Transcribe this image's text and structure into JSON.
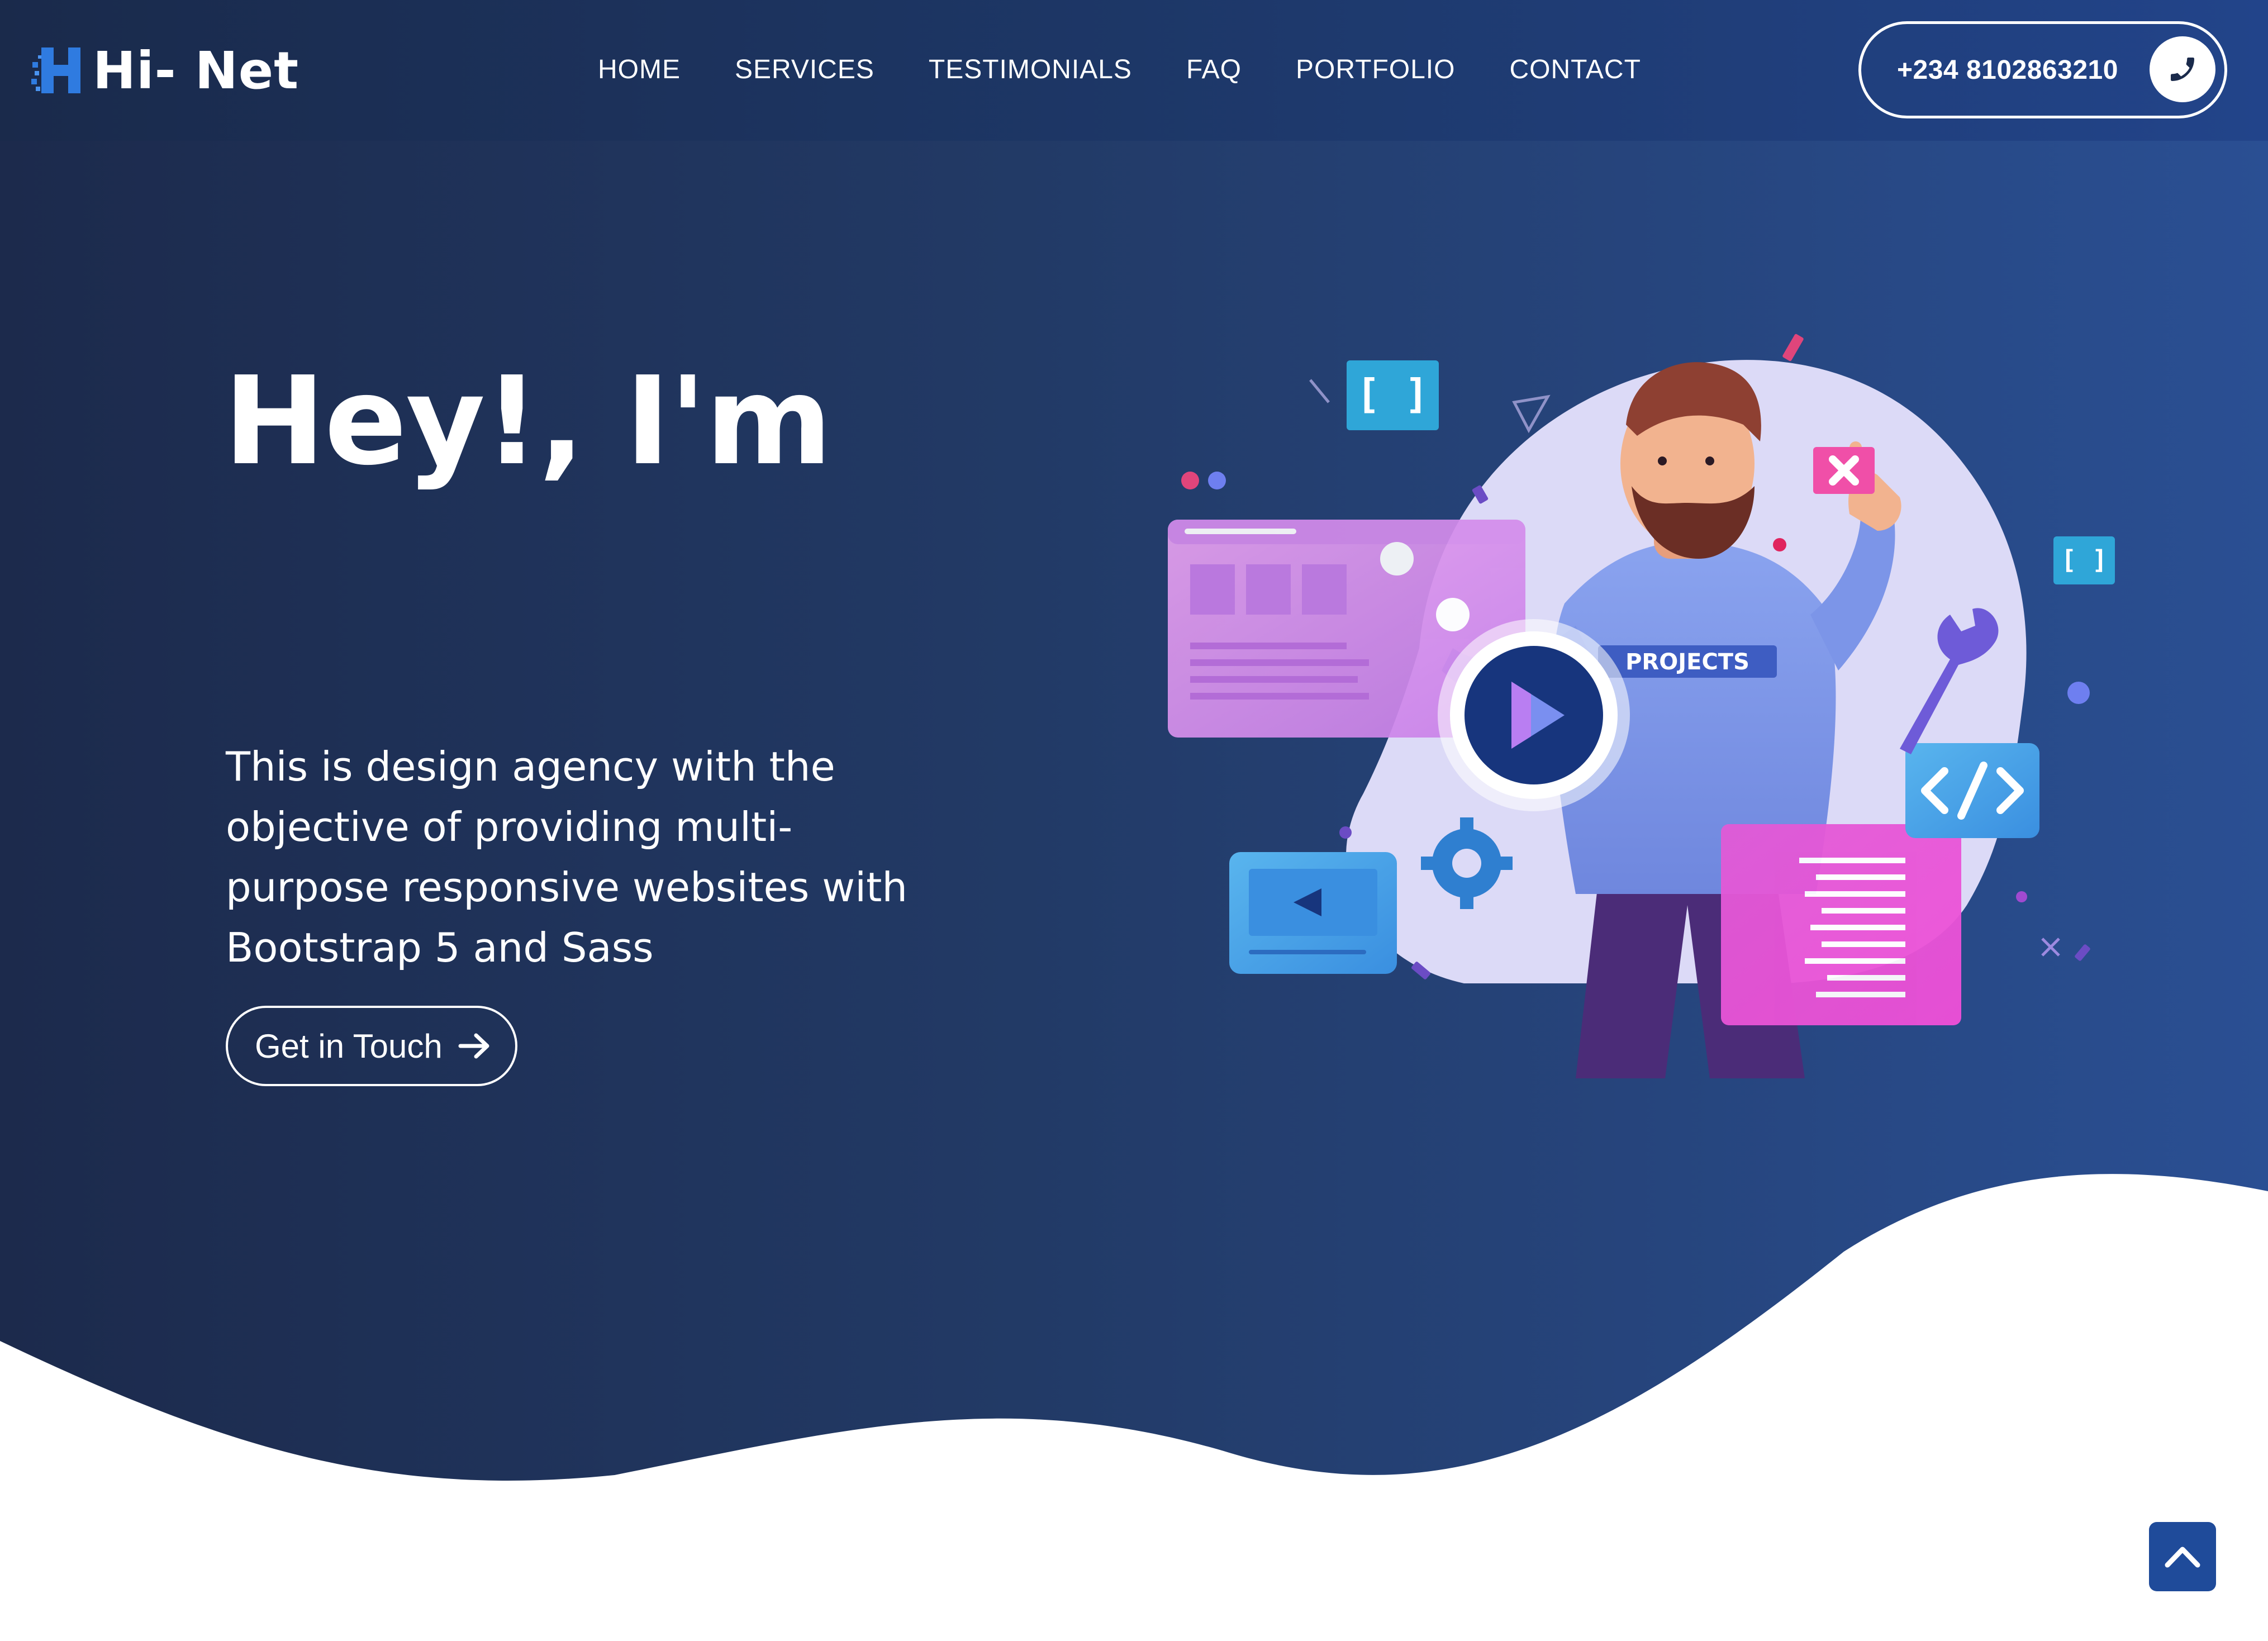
{
  "brand": {
    "name": "Hi- Net"
  },
  "nav": {
    "items": [
      {
        "label": "HOME"
      },
      {
        "label": "SERVICES"
      },
      {
        "label": "TESTIMONIALS"
      },
      {
        "label": "FAQ"
      },
      {
        "label": "PORTFOLIO"
      },
      {
        "label": "CONTACT"
      }
    ]
  },
  "contact": {
    "phone": "+234 8102863210",
    "phone_icon": "phone-icon"
  },
  "hero": {
    "title": "Hey!, I'm",
    "description": "This is design agency with the objective of providing multi-purpose responsive websites with Bootstrap 5 and Sass",
    "cta_label": "Get in Touch",
    "cta_icon": "arrow-right-icon",
    "illustration_sign": "PROJECTS",
    "play_icon": "play-icon"
  },
  "scroll_top": {
    "icon": "chevron-up-icon"
  },
  "colors": {
    "hero_start": "#1c2a4c",
    "hero_end": "#2a4f93",
    "accent": "#1f4b9a",
    "white": "#ffffff"
  }
}
